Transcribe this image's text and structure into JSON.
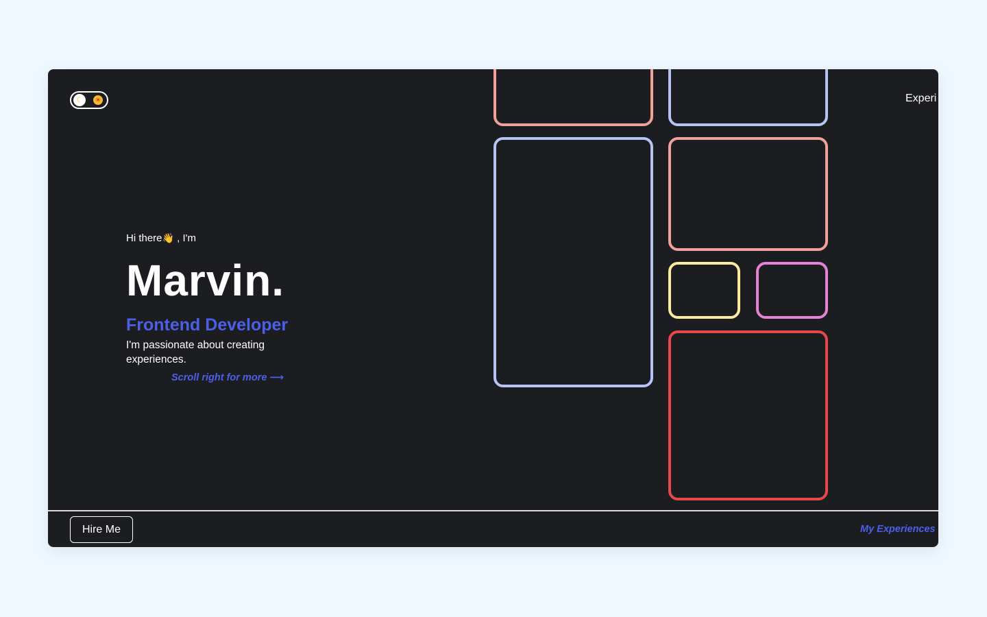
{
  "theme_toggle": {
    "moon_icon": "moon-icon",
    "sun_icon": "sun-icon"
  },
  "nav": {
    "experience_link": "Experi"
  },
  "hero": {
    "greeting_pre": "Hi there",
    "wave_emoji": "👋",
    "greeting_post": ", I'm",
    "name": "Marvin.",
    "role": "Frontend Developer",
    "tagline": "I'm passionate about creating experiences.",
    "scroll_hint": "Scroll right for more ⟶"
  },
  "footer": {
    "hire_label": "Hire Me",
    "experiences_link": "My Experiences ⟶"
  },
  "colors": {
    "background": "#eff7ff",
    "window": "#1c1d21",
    "accent": "#4c5fe8",
    "box_salmon": "#f0a29a",
    "box_periwinkle": "#b7c3f5",
    "box_yellow": "#fbeaa0",
    "box_pink": "#e681d8",
    "box_red": "#e8474c"
  }
}
